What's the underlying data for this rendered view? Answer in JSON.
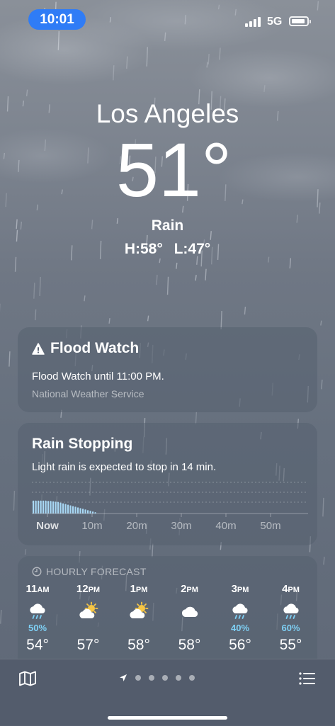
{
  "status_bar": {
    "time": "10:01",
    "network": "5G"
  },
  "location": {
    "city": "Los Angeles",
    "temperature": "51°",
    "condition": "Rain",
    "high": "H:58°",
    "low": "L:47°"
  },
  "alert_card": {
    "title": "Flood Watch",
    "message": "Flood Watch until 11:00 PM.",
    "source": "National Weather Service",
    "icon": "warning-triangle-icon"
  },
  "precip_card": {
    "title": "Rain Stopping",
    "description": "Light rain is expected to stop in 14 min.",
    "ticks": [
      "Now",
      "10m",
      "20m",
      "30m",
      "40m",
      "50m"
    ],
    "intensity": [
      0.38,
      0.38,
      0.38,
      0.38,
      0.38,
      0.38,
      0.37,
      0.37,
      0.36,
      0.35,
      0.34,
      0.32,
      0.3,
      0.28,
      0.26,
      0.24,
      0.22,
      0.2,
      0.18,
      0.16,
      0.14,
      0.12,
      0.1,
      0.08,
      0.06,
      0.04
    ],
    "bar_color": "#a8d8f5"
  },
  "hourly": {
    "header": "HOURLY FORECAST",
    "items": [
      {
        "hour": "11",
        "ampm": "AM",
        "icon": "rain-cloud-icon",
        "pop": "50%",
        "temp": "54°"
      },
      {
        "hour": "12",
        "ampm": "PM",
        "icon": "partly-sunny-icon",
        "pop": "",
        "temp": "57°"
      },
      {
        "hour": "1",
        "ampm": "PM",
        "icon": "partly-sunny-icon",
        "pop": "",
        "temp": "58°"
      },
      {
        "hour": "2",
        "ampm": "PM",
        "icon": "cloud-icon",
        "pop": "",
        "temp": "58°"
      },
      {
        "hour": "3",
        "ampm": "PM",
        "icon": "rain-cloud-icon",
        "pop": "40%",
        "temp": "56°"
      },
      {
        "hour": "4",
        "ampm": "PM",
        "icon": "rain-cloud-icon",
        "pop": "60%",
        "temp": "55°"
      }
    ]
  },
  "toolbar": {
    "page_count": 6,
    "current_page": "location-arrow"
  },
  "colors": {
    "time_pill": "#2f7cf6",
    "pop_text": "#7ed0f5",
    "sun": "#f6c544"
  }
}
